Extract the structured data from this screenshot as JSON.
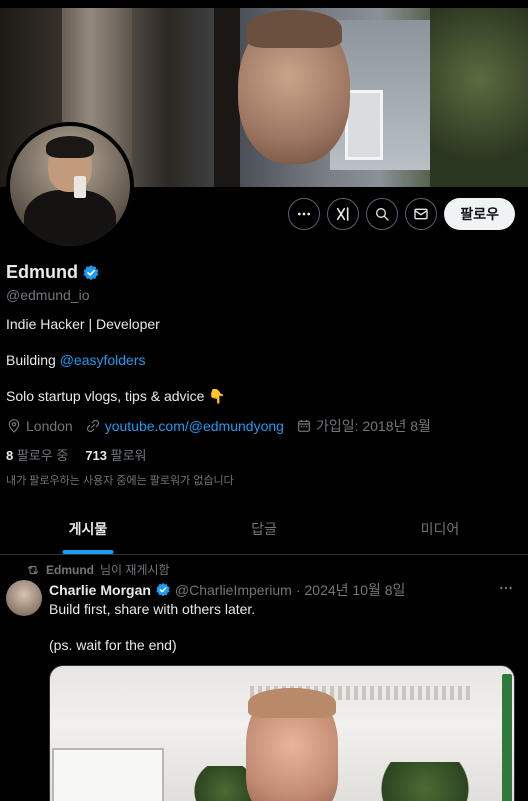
{
  "profile": {
    "name": "Edmund",
    "handle": "@edmund_io",
    "bio_line1": "Indie Hacker | Developer",
    "bio_building_prefix": "Building ",
    "bio_building_link": "@easyfolders",
    "bio_line3": "Solo startup vlogs, tips & advice 👇",
    "location": "London",
    "website": "youtube.com/@edmundyong",
    "joined": "가입일: 2018년 8월",
    "following_count": "8",
    "following_label": "팔로우 중",
    "followers_count": "713",
    "followers_label": "팔로워",
    "followers_note": "내가 팔로우하는 사용자 중에는 팔로워가 없습니다"
  },
  "actions": {
    "follow_label": "팔로우",
    "icons": [
      "more-icon",
      "grok-icon",
      "search-icon",
      "message-icon"
    ]
  },
  "tabs": [
    {
      "label": "게시물",
      "active": true
    },
    {
      "label": "답글",
      "active": false
    },
    {
      "label": "미디어",
      "active": false
    }
  ],
  "post": {
    "repost_name": "Edmund",
    "repost_label": "님이 재게시함",
    "author_name": "Charlie Morgan",
    "author_handle": "@CharlieImperium",
    "separator": "·",
    "date": "2024년 10월 8일",
    "text_line1": "Build first, share with others later.",
    "text_line2": "(ps. wait for the end)"
  },
  "colors": {
    "accent": "#1d9bf0",
    "muted": "#71767b",
    "text": "#e7e9ea",
    "background": "#000000",
    "border": "#2f3336"
  }
}
